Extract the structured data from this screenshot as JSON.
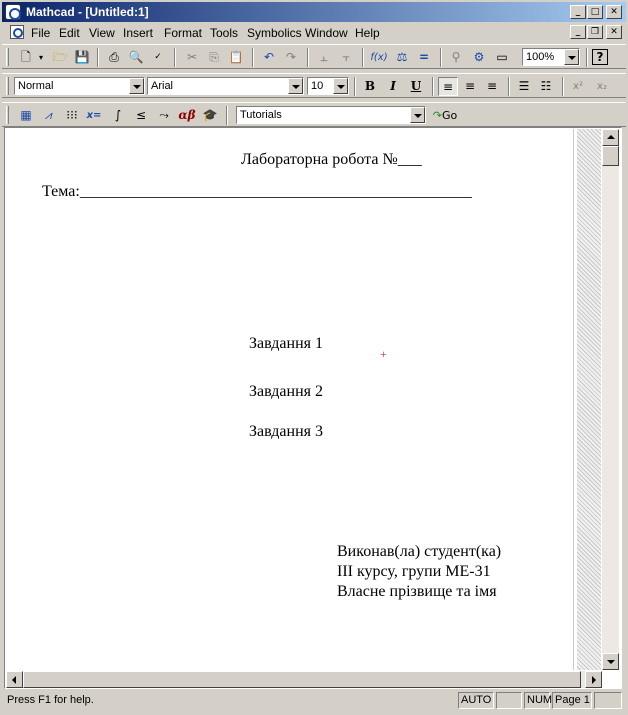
{
  "window": {
    "title": "Mathcad - [Untitled:1]"
  },
  "menu": [
    "File",
    "Edit",
    "View",
    "Insert",
    "Format",
    "Tools",
    "Symbolics",
    "Window",
    "Help"
  ],
  "toolbar": {
    "zoom": "100%"
  },
  "format_bar": {
    "style": "Normal",
    "font": "Arial",
    "size": "10",
    "bold": "B",
    "italic": "I",
    "underline": "U"
  },
  "math_bar": {
    "resource": "Tutorials",
    "go": "Go",
    "eval_label": "x=",
    "greek_label": "αβ"
  },
  "document": {
    "title_line": "Лабораторна робота №___",
    "topic_line": "Тема:_________________________________________________",
    "task1": "Завдання 1",
    "task2": "Завдання 2",
    "task3": "Завдання 3",
    "sign1": "Виконав(ла) студент(ка)",
    "sign2": "ІІІ курсу, групи МЕ-31",
    "sign3": "Власне прізвище та імя"
  },
  "status": {
    "help": "Press F1 for help.",
    "mode": "AUTO",
    "num": "NUM",
    "page": "Page 1"
  }
}
